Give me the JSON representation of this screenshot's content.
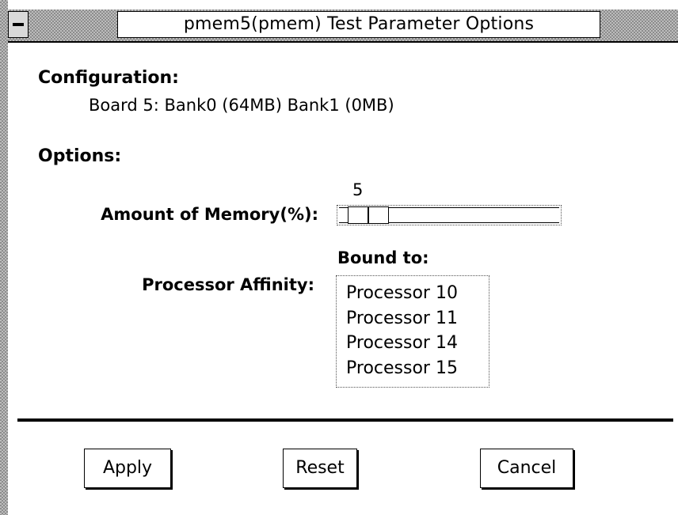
{
  "window": {
    "title": "pmem5(pmem) Test Parameter Options"
  },
  "configuration": {
    "heading": "Configuration:",
    "board_info": "Board 5: Bank0 (64MB) Bank1 (0MB)"
  },
  "options": {
    "heading": "Options:",
    "memory": {
      "label": "Amount of Memory(%):",
      "value": "5",
      "min": 0,
      "max": 100
    },
    "affinity": {
      "label": "Processor Affinity:",
      "bound_label": "Bound to:",
      "processors": [
        "Processor 10",
        "Processor 11",
        "Processor 14",
        "Processor 15"
      ]
    }
  },
  "buttons": {
    "apply": "Apply",
    "reset": "Reset",
    "cancel": "Cancel"
  },
  "colors": {
    "frame": "#bdbdbd",
    "frame_dark": "#8c8c8c",
    "background": "#ffffff",
    "text": "#000000"
  },
  "icons": {
    "window_menu": "window-menu-icon"
  }
}
